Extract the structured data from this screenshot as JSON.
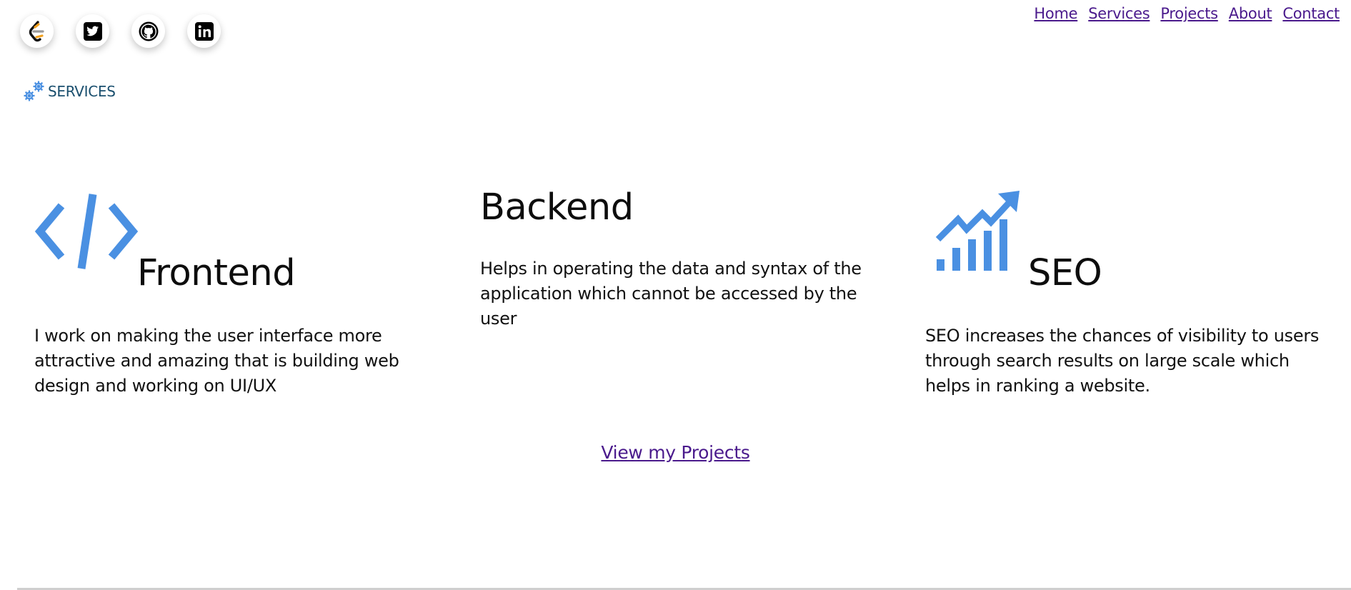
{
  "social": [
    {
      "name": "leetcode-icon",
      "label": "LeetCode"
    },
    {
      "name": "twitter-icon",
      "label": "Twitter"
    },
    {
      "name": "github-icon",
      "label": "GitHub"
    },
    {
      "name": "linkedin-icon",
      "label": "LinkedIn"
    }
  ],
  "nav": {
    "items": [
      "Home",
      "Services",
      "Projects",
      "About",
      "Contact"
    ]
  },
  "section": {
    "title": "SERVICES",
    "icon": "gears-icon"
  },
  "services": {
    "frontend": {
      "title": "Frontend",
      "icon": "code-icon",
      "text": "I work on making the user interface more attractive and amazing that is building web design and working on UI/UX"
    },
    "backend": {
      "title": "Backend",
      "text": "Helps in operating the data and syntax of the application which cannot be accessed by the user"
    },
    "seo": {
      "title": "SEO",
      "icon": "growth-chart-icon",
      "text": "SEO increases the chances of visibility to users through search results on large scale which helps in ranking a website."
    }
  },
  "projects_link": "View my Projects",
  "colors": {
    "link": "#4a1a8c",
    "accent_blue": "#4a90e2",
    "heading_teal": "#1a4f6e"
  }
}
